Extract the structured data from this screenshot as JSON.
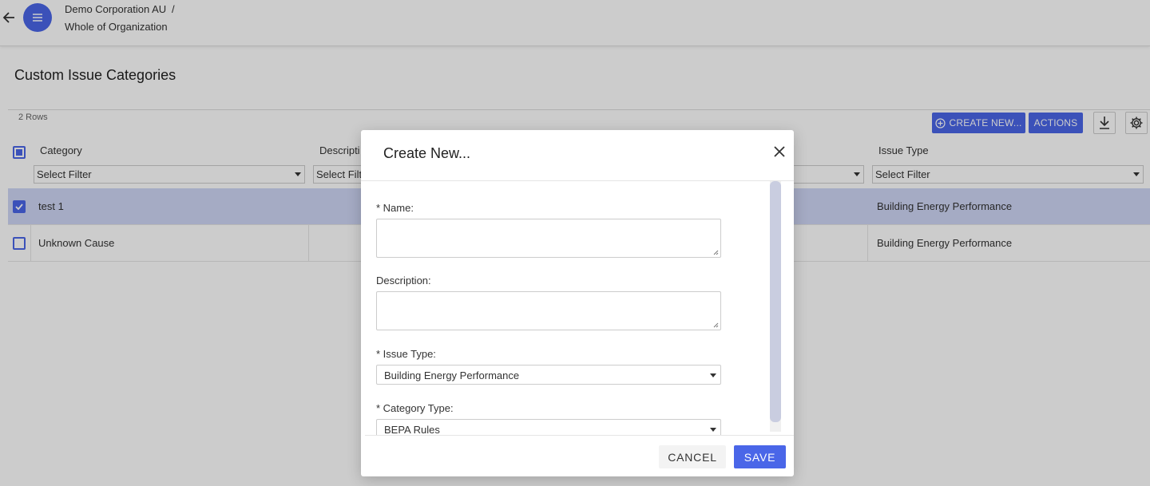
{
  "header": {
    "org": "Demo Corporation AU",
    "separator": "/",
    "scope": "Whole of Organization"
  },
  "page": {
    "title": "Custom Issue Categories",
    "rows_count": "2 Rows",
    "create_label": "CREATE NEW...",
    "actions_label": "ACTIONS"
  },
  "grid": {
    "columns": [
      "Category",
      "Descripti",
      "Issue Type"
    ],
    "filter_placeholder": "Select Filter",
    "filter_placeholder_short": "Select Filt",
    "rows": [
      {
        "category": "test 1",
        "issue_type": "Building Energy Performance",
        "selected": true
      },
      {
        "category": "Unknown Cause",
        "issue_type": "Building Energy Performance",
        "selected": false
      }
    ]
  },
  "modal": {
    "title": "Create New...",
    "name_label": "* Name:",
    "description_label": "Description:",
    "issue_type_label": "* Issue Type:",
    "issue_type_value": "Building Energy Performance",
    "category_type_label": "* Category Type:",
    "category_type_value": "BEPA Rules",
    "cancel_label": "CANCEL",
    "save_label": "SAVE"
  },
  "colors": {
    "accent": "#4a66e8",
    "selected_row": "#cfd6f6"
  }
}
